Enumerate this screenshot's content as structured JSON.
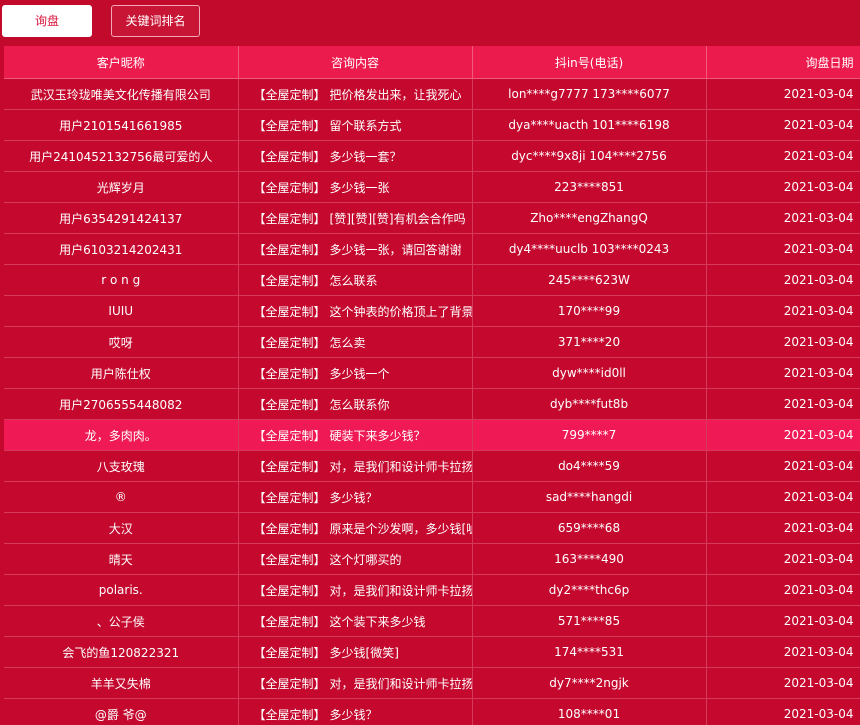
{
  "tabs": {
    "inquiry": "询盘",
    "keyword_rank": "关键词排名"
  },
  "table": {
    "columns": [
      "客户昵称",
      "咨询内容",
      "抖in号(电话)",
      "询盘日期"
    ],
    "highlighted_row": 11,
    "rows": [
      {
        "name": "武汉玉玲珑唯美文化传播有限公司",
        "tag": "【全屋定制】",
        "content": "把价格发出来，让我死心",
        "phone": "lon****g7777 173****6077",
        "date": "2021-03-04"
      },
      {
        "name": "用户2101541661985",
        "tag": "【全屋定制】",
        "content": "留个联系方式",
        "phone": "dya****uacth 101****6198",
        "date": "2021-03-04"
      },
      {
        "name": "用户2410452132756最可爱的人",
        "tag": "【全屋定制】",
        "content": "多少钱一套？",
        "phone": "dyc****9x8ji 104****2756",
        "date": "2021-03-04"
      },
      {
        "name": "光辉岁月",
        "tag": "【全屋定制】",
        "content": "多少钱一张",
        "phone": "223****851",
        "date": "2021-03-04"
      },
      {
        "name": "用户6354291424137",
        "tag": "【全屋定制】",
        "content": "[赞][赞][赞]有机会合作吗",
        "phone": "Zho****engZhangQ",
        "date": "2021-03-04"
      },
      {
        "name": "用户6103214202431",
        "tag": "【全屋定制】",
        "content": "多少钱一张，请回答谢谢",
        "phone": "dy4****uuclb 103****0243",
        "date": "2021-03-04"
      },
      {
        "name": "r o n g",
        "tag": "【全屋定制】",
        "content": "怎么联系",
        "phone": "245****623W",
        "date": "2021-03-04"
      },
      {
        "name": "IUIU",
        "tag": "【全屋定制】",
        "content": "这个钟表的价格顶上了背景墙的",
        "phone": "170****99",
        "date": "2021-03-04"
      },
      {
        "name": "哎呀",
        "tag": "【全屋定制】",
        "content": "怎么卖",
        "phone": "371****20",
        "date": "2021-03-04"
      },
      {
        "name": "用户陈仕权",
        "tag": "【全屋定制】",
        "content": "多少钱一个",
        "phone": "dyw****id0ll",
        "date": "2021-03-04"
      },
      {
        "name": "用户2706555448082",
        "tag": "【全屋定制】",
        "content": "怎么联系你",
        "phone": "dyb****fut8b",
        "date": "2021-03-04"
      },
      {
        "name": "龙，多肉肉。",
        "tag": "【全屋定制】",
        "content": "硬装下来多少钱？",
        "phone": "799****7",
        "date": "2021-03-04"
      },
      {
        "name": "八支玫瑰",
        "tag": "【全屋定制】",
        "content": "对，是我们和设计师卡拉扬合作",
        "phone": "do4****59",
        "date": "2021-03-04"
      },
      {
        "name": "®",
        "tag": "【全屋定制】",
        "content": "多少钱？",
        "phone": "sad****hangdi",
        "date": "2021-03-04"
      },
      {
        "name": "大汉",
        "tag": "【全屋定制】",
        "content": "原来是个沙发啊，多少钱[呲牙]",
        "phone": "659****68",
        "date": "2021-03-04"
      },
      {
        "name": "晴天",
        "tag": "【全屋定制】",
        "content": "这个灯哪买的",
        "phone": "163****490",
        "date": "2021-03-04"
      },
      {
        "name": "polaris.",
        "tag": "【全屋定制】",
        "content": "对，是我们和设计师卡拉扬合作",
        "phone": "dy2****thc6p",
        "date": "2021-03-04"
      },
      {
        "name": "、公子侯",
        "tag": "【全屋定制】",
        "content": "这个装下来多少钱",
        "phone": "571****85",
        "date": "2021-03-04"
      },
      {
        "name": "会飞的鱼120822321",
        "tag": "【全屋定制】",
        "content": "多少钱[微笑]",
        "phone": "174****531",
        "date": "2021-03-04"
      },
      {
        "name": "羊羊又失棉",
        "tag": "【全屋定制】",
        "content": "对，是我们和设计师卡拉扬合作",
        "phone": "dy7****2ngjk",
        "date": "2021-03-04"
      },
      {
        "name": "@爵 爷@",
        "tag": "【全屋定制】",
        "content": "多少钱？",
        "phone": "108****01",
        "date": "2021-03-04"
      }
    ]
  }
}
